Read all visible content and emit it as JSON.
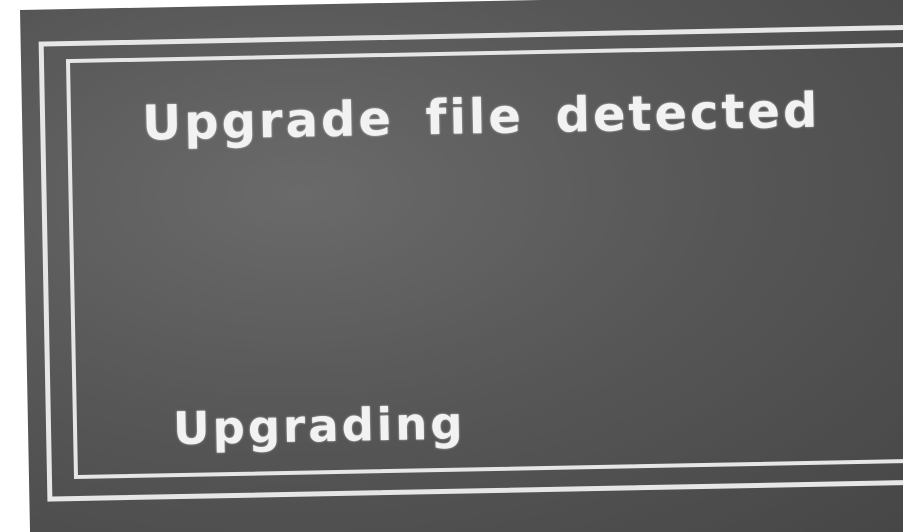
{
  "dialog": {
    "title": "Upgrade file detected",
    "status": "Upgrading"
  }
}
